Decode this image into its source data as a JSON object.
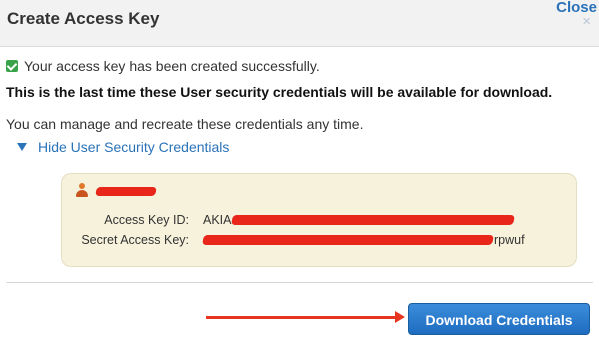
{
  "dialog": {
    "title": "Create Access Key",
    "close_label": "Close",
    "close_x": "×"
  },
  "messages": {
    "success": "Your access key has been created successfully.",
    "warning": "This is the last time these User security credentials will be available for download.",
    "manage": "You can manage and recreate these credentials any time."
  },
  "toggle": {
    "label": "Hide User Security Credentials"
  },
  "credentials": {
    "access_key_label": "Access Key ID:",
    "access_key_prefix": "AKIA",
    "secret_key_label": "Secret Access Key:",
    "secret_key_suffix": "rpwuf"
  },
  "actions": {
    "download_label": "Download Credentials"
  },
  "colors": {
    "accent": "#2a73b8",
    "redaction": "#e8271a",
    "button": "#1e6cc0",
    "panel": "#f6f2dc"
  }
}
